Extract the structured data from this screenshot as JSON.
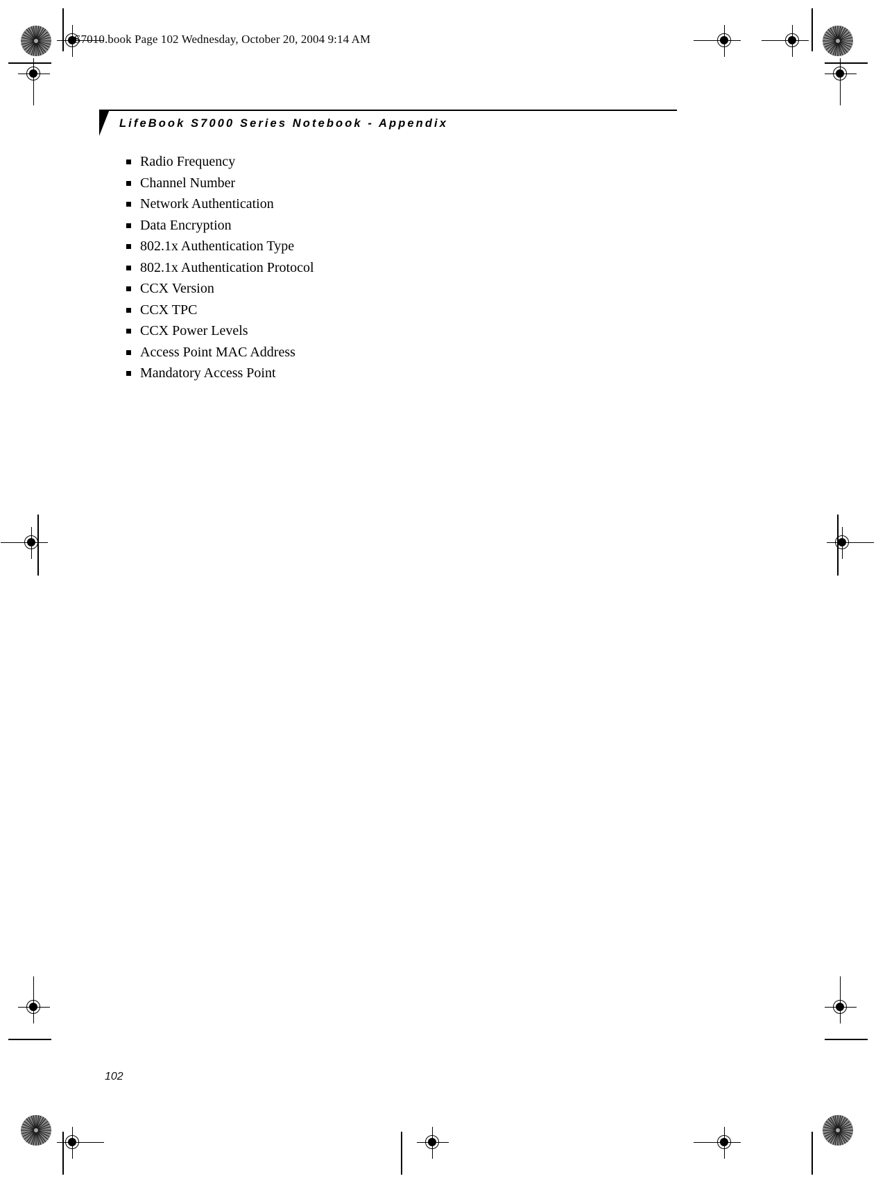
{
  "document": {
    "slug_line": "S7010.book  Page 102  Wednesday, October 20, 2004  9:14 AM",
    "running_head": "LifeBook S7000 Series Notebook - Appendix",
    "page_number": "102",
    "list": [
      {
        "label": "Radio Frequency"
      },
      {
        "label": "Channel Number"
      },
      {
        "label": "Network Authentication"
      },
      {
        "label": "Data Encryption"
      },
      {
        "label": "802.1x Authentication Type"
      },
      {
        "label": "802.1x Authentication Protocol"
      },
      {
        "label": "CCX Version"
      },
      {
        "label": "CCX TPC"
      },
      {
        "label": "CCX Power Levels"
      },
      {
        "label": "Access Point MAC Address"
      },
      {
        "label": "Mandatory Access Point"
      }
    ]
  },
  "marks": {
    "registration_icon": "registration-target-icon",
    "rosette_icon": "color-rosette-icon",
    "crop_icon": "crop-rule"
  },
  "colors": {
    "ink": "#000000",
    "paper": "#ffffff",
    "rosette_gray": "#7d7d7d"
  }
}
